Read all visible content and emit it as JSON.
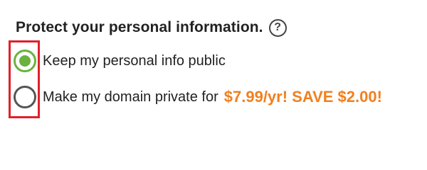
{
  "section": {
    "heading": "Protect your personal information.",
    "help_icon": "question-circle-icon",
    "help_glyph": "?"
  },
  "options": [
    {
      "label": "Keep my personal info public",
      "selected": true
    },
    {
      "label": "Make my domain private for",
      "price_text": "$7.99/yr! SAVE $2.00!",
      "selected": false
    }
  ],
  "colors": {
    "radio_selected": "#6ab23e",
    "radio_unselected": "#555555",
    "price": "#f08020",
    "highlight_box": "#e0202a",
    "text": "#222222"
  }
}
